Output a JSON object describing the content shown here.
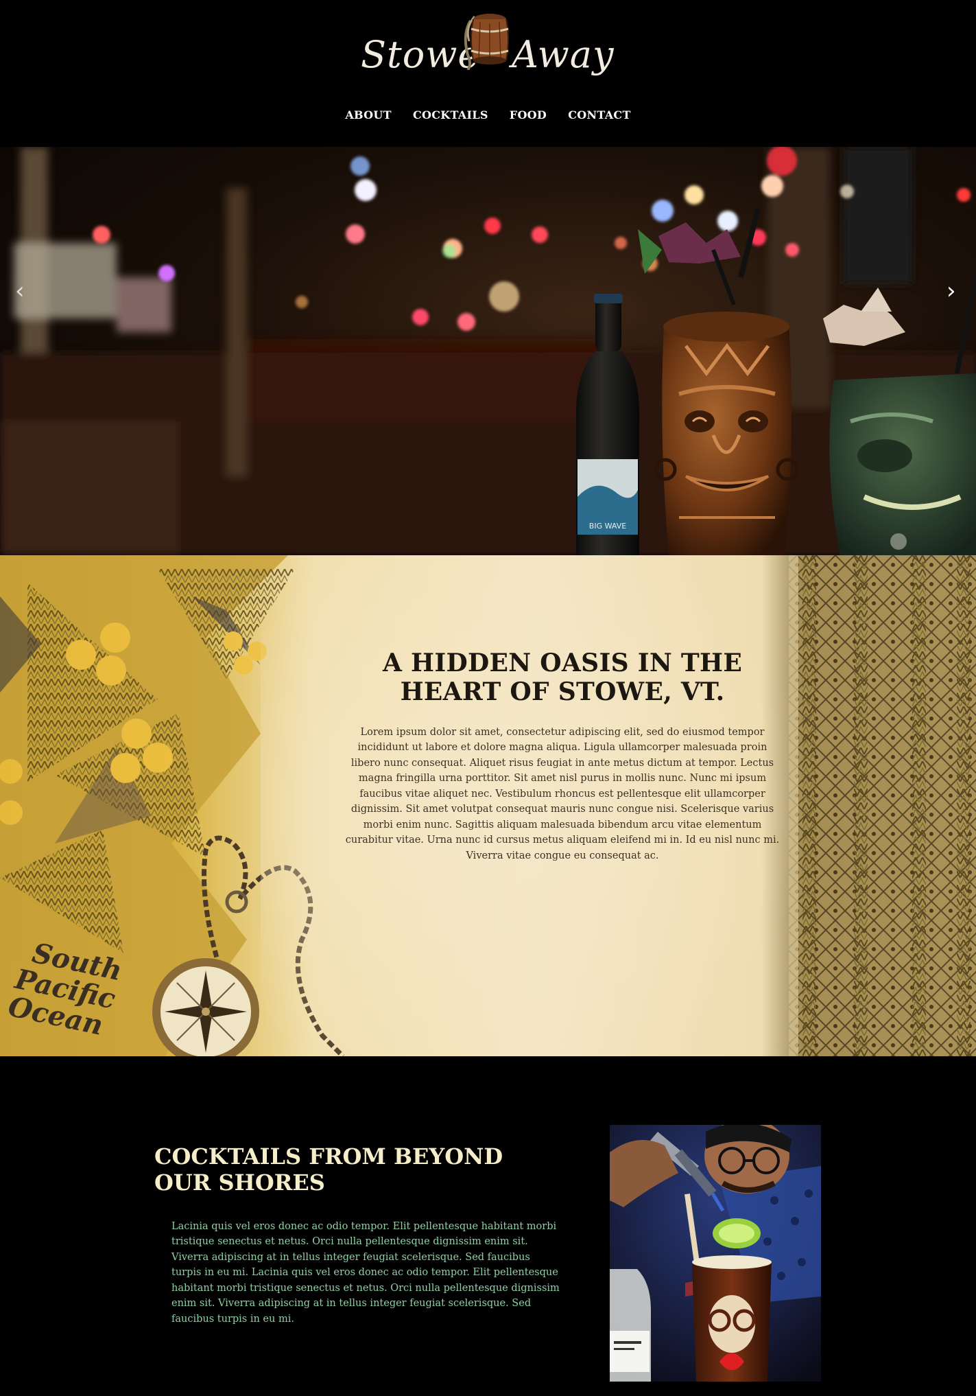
{
  "brand": {
    "logo_text_left": "Stowe",
    "logo_text_right": "Away"
  },
  "nav": {
    "items": [
      {
        "label": "ABOUT"
      },
      {
        "label": "COCKTAILS"
      },
      {
        "label": "FOOD"
      },
      {
        "label": "CONTACT"
      }
    ]
  },
  "hero": {
    "prev_icon": "chevron-left-icon",
    "next_icon": "chevron-right-icon",
    "prev_glyph": "‹",
    "next_glyph": "›",
    "bottle_label": "BIG WAVE"
  },
  "intro": {
    "title": "A HIDDEN OASIS IN THE HEART OF STOWE, VT.",
    "body": "Lorem ipsum dolor sit amet, consectetur adipiscing elit, sed do eiusmod tempor incididunt ut labore et dolore magna aliqua. Ligula ullamcorper malesuada proin libero nunc consequat. Aliquet risus feugiat in ante metus dictum at tempor. Lectus magna fringilla urna porttitor. Sit amet nisl purus in mollis nunc. Nunc mi ipsum faucibus vitae aliquet nec. Vestibulum rhoncus est pellentesque elit ullamcorper dignissim. Sit amet volutpat consequat mauris nunc congue nisi. Scelerisque varius morbi enim nunc. Sagittis aliquam malesuada bibendum arcu vitae elementum curabitur vitae. Urna nunc id cursus metus aliquam eleifend mi in. Id eu nisl nunc mi. Viverra vitae congue eu consequat ac.",
    "map_text_1": "South",
    "map_text_2": "Pacific",
    "map_text_3": "Ocean"
  },
  "cocktails": {
    "title": "COCKTAILS FROM BEYOND OUR SHORES",
    "body": "Lacinia quis vel eros donec ac odio tempor. Elit pellentesque habitant morbi tristique senectus et netus. Orci nulla pellentesque dignissim enim sit. Viverra adipiscing at in tellus integer feugiat scelerisque. Sed faucibus turpis in eu mi. Lacinia quis vel eros donec ac odio tempor. Elit pellentesque habitant morbi tristique senectus et netus. Orci nulla pellentesque dignissim enim sit. Viverra adipiscing at in tellus integer feugiat scelerisque. Sed faucibus turpis in eu mi."
  },
  "colors": {
    "page_bg": "#000000",
    "nav_text": "#ffffff",
    "intro_title": "#1c1710",
    "cocktails_title": "#f5eec8",
    "cocktails_body": "#8fd0a4"
  }
}
